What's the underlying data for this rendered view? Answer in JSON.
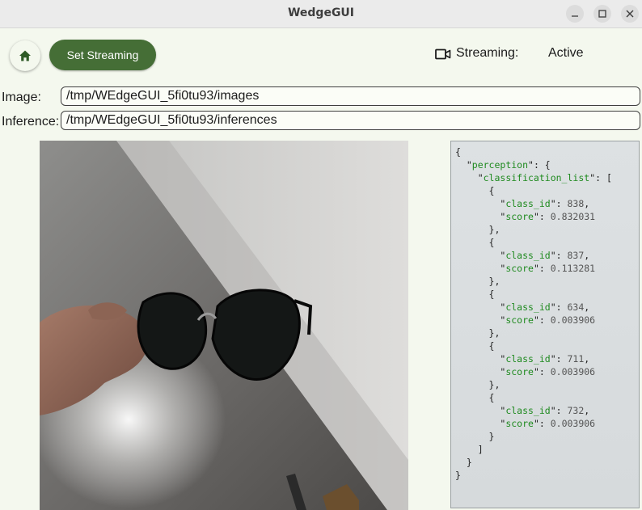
{
  "window": {
    "title": "WedgeGUI",
    "controls": [
      "minimize-icon",
      "maximize-icon",
      "close-icon"
    ]
  },
  "toolbar": {
    "home_icon": "home-icon",
    "stream_button_label": "Set Streaming",
    "camera_icon": "video-camera-icon",
    "streaming_label": "Streaming:",
    "streaming_value": "Active"
  },
  "paths": {
    "image_label": "Image:",
    "image_value": "/tmp/WEdgeGUI_5fi0tu93/images",
    "inference_label": "Inference:",
    "inference_value": "/tmp/WEdgeGUI_5fi0tu93/inferences"
  },
  "camera_image": "Photo of a hand holding dark sunglasses against a white wall",
  "inference_json": {
    "perception_key": "perception",
    "list_key": "classification_list",
    "id_key": "class_id",
    "score_key": "score",
    "items": [
      {
        "class_id": "838",
        "score": "0.832031"
      },
      {
        "class_id": "837",
        "score": "0.113281"
      },
      {
        "class_id": "634",
        "score": "0.003906"
      },
      {
        "class_id": "711",
        "score": "0.003906"
      },
      {
        "class_id": "732",
        "score": "0.003906"
      }
    ]
  },
  "colors": {
    "accent": "#456e36",
    "background": "#f4f8ee",
    "json_key": "#1f8a1f",
    "json_panel": "#dde1e3"
  }
}
